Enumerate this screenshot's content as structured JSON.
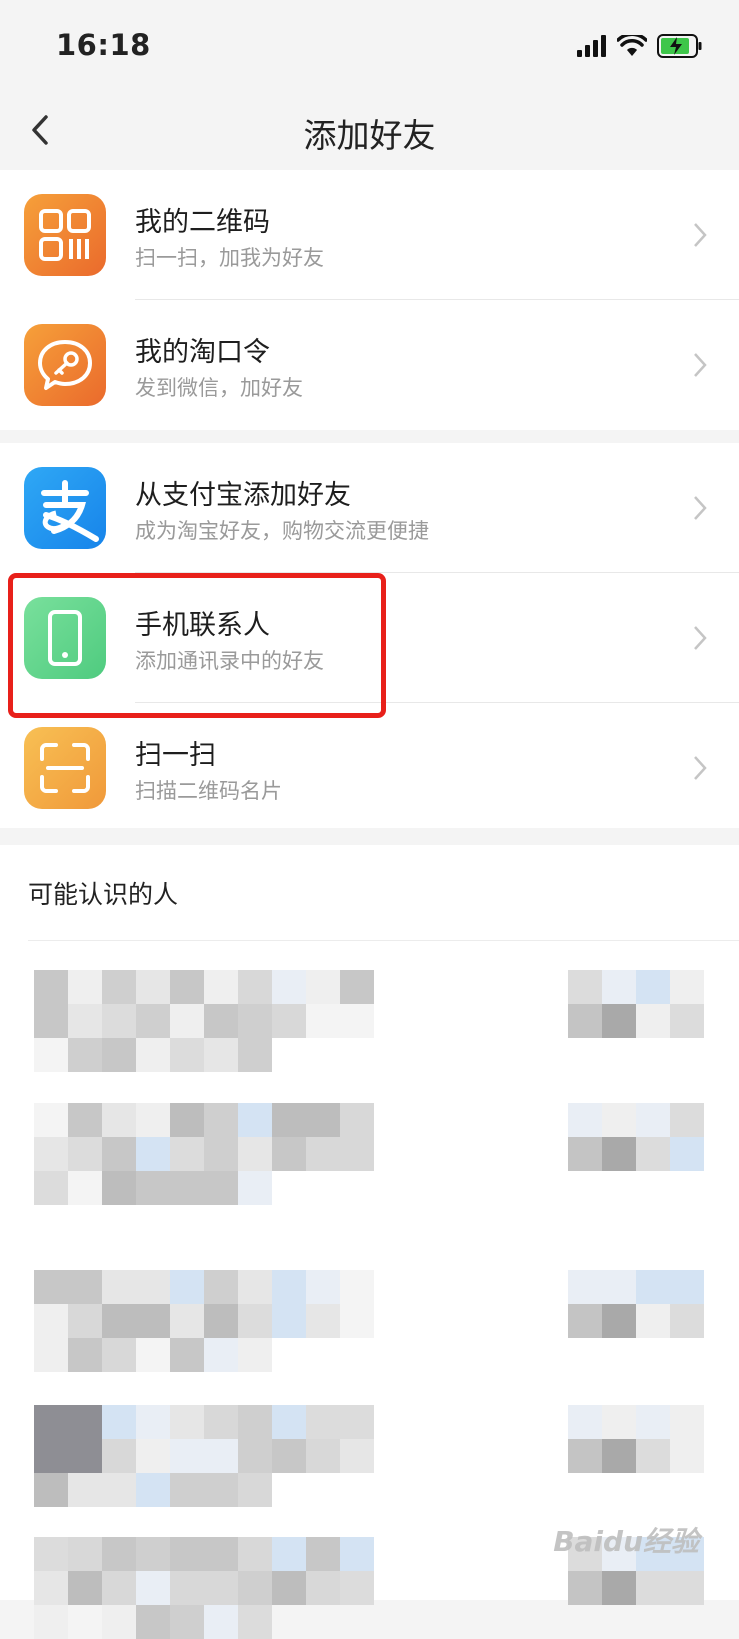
{
  "status_bar": {
    "time": "16:18"
  },
  "nav": {
    "title": "添加好友"
  },
  "items": [
    {
      "title": "我的二维码",
      "subtitle": "扫一扫，加我为好友",
      "icon": "qr-code-icon"
    },
    {
      "title": "我的淘口令",
      "subtitle": "发到微信，加好友",
      "icon": "taokouling-icon"
    },
    {
      "title": "从支付宝添加好友",
      "subtitle": "成为淘宝好友，购物交流更便捷",
      "icon": "alipay-icon"
    },
    {
      "title": "手机联系人",
      "subtitle": "添加通讯录中的好友",
      "icon": "phone-icon"
    },
    {
      "title": "扫一扫",
      "subtitle": "扫描二维码名片",
      "icon": "scan-icon"
    }
  ],
  "people": {
    "title": "可能认识的人"
  },
  "watermark": "Baidu经验",
  "colors": {
    "highlight": "#e8201a",
    "orange": "#f0812e",
    "blue": "#1a8ef0",
    "green": "#5dd48a",
    "yellow": "#f3a840"
  }
}
